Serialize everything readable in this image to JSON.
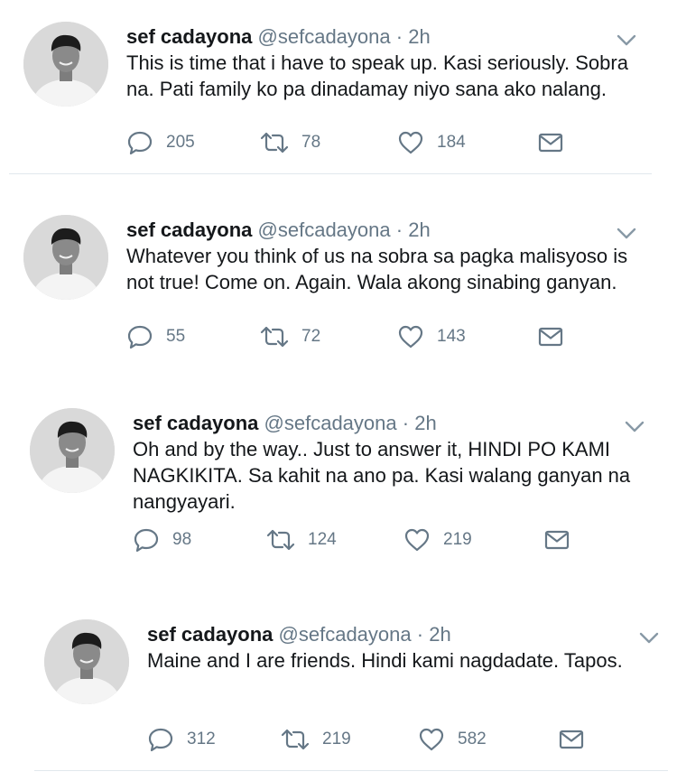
{
  "tweets": [
    {
      "name": "sef cadayona",
      "handle": "@sefcadayona",
      "separator": "·",
      "time": "2h",
      "text": "This is time that i have to speak up. Kasi seriously. Sobra na. Pati family ko pa dinadamay niyo sana ako nalang.",
      "replies": "205",
      "retweets": "78",
      "likes": "184"
    },
    {
      "name": "sef cadayona",
      "handle": "@sefcadayona",
      "separator": "·",
      "time": "2h",
      "text": "Whatever you think of us na sobra sa pagka malisyoso is not true! Come on. Again. Wala akong sinabing ganyan.",
      "replies": "55",
      "retweets": "72",
      "likes": "143"
    },
    {
      "name": "sef cadayona",
      "handle": "@sefcadayona",
      "separator": "·",
      "time": "2h",
      "text": "Oh and by the way.. Just to answer it, HINDI PO KAMI NAGKIKITA. Sa kahit na ano pa. Kasi walang ganyan na nangyayari.",
      "replies": "98",
      "retweets": "124",
      "likes": "219"
    },
    {
      "name": "sef cadayona",
      "handle": "@sefcadayona",
      "separator": "·",
      "time": "2h",
      "text": "Maine and I are friends. Hindi kami nagdadate. Tapos.",
      "replies": "312",
      "retweets": "219",
      "likes": "582"
    }
  ],
  "icons": {
    "reply": "reply-icon",
    "retweet": "retweet-icon",
    "like": "heart-icon",
    "message": "direct-message-icon",
    "menu": "chevron-down-icon",
    "avatar": "profile-photo"
  },
  "colors": {
    "text": "#14171a",
    "secondary": "#657786",
    "divider": "#e1e8ed",
    "background": "#ffffff"
  }
}
